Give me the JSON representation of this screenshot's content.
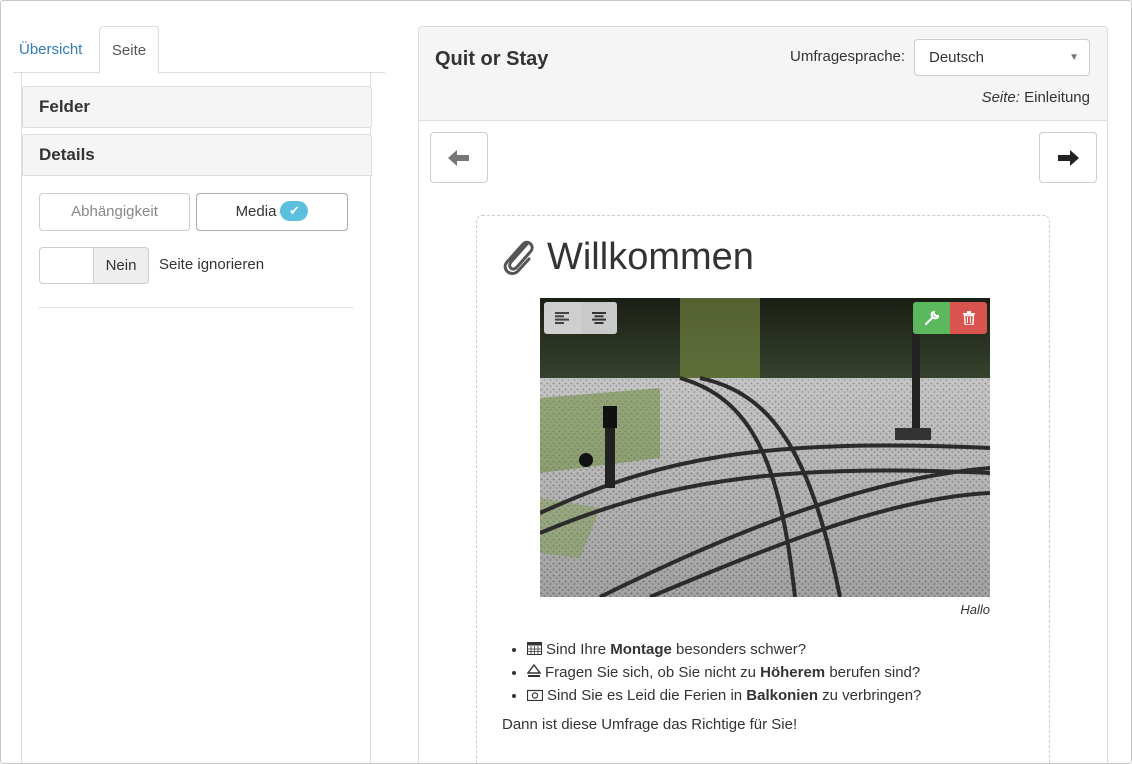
{
  "sidebar": {
    "tabs": [
      {
        "label": "Übersicht"
      },
      {
        "label": "Seite"
      }
    ],
    "sections": {
      "felder": "Felder",
      "details": "Details"
    },
    "buttons": {
      "dependency": "Abhängigkeit",
      "media": "Media"
    },
    "toggle": {
      "value": "Nein",
      "label": "Seite ignorieren"
    }
  },
  "main": {
    "survey_title": "Quit or Stay",
    "language_label": "Umfragesprache:",
    "language_value": "Deutsch",
    "page_info_label": "Seite:",
    "page_info_value": "Einleitung",
    "heading": "Willkommen",
    "image_caption": "Hallo",
    "bullets": [
      {
        "icon": "calendar-icon",
        "pre": "Sind Ihre ",
        "bold": "Montage",
        "post": " besonders schwer?"
      },
      {
        "icon": "eject-icon",
        "pre": "Fragen Sie sich, ob Sie nicht zu ",
        "bold": "Höherem",
        "post": " berufen sind?"
      },
      {
        "icon": "money-icon",
        "pre": "Sind Sie es Leid die Ferien in ",
        "bold": "Balkonien",
        "post": " zu verbringen?"
      }
    ],
    "outro": "Dann ist diese Umfrage das Richtige für Sie!"
  },
  "colors": {
    "link": "#337ab7",
    "info_badge": "#5bc0de",
    "success": "#5cb85c",
    "danger": "#d9534f"
  }
}
